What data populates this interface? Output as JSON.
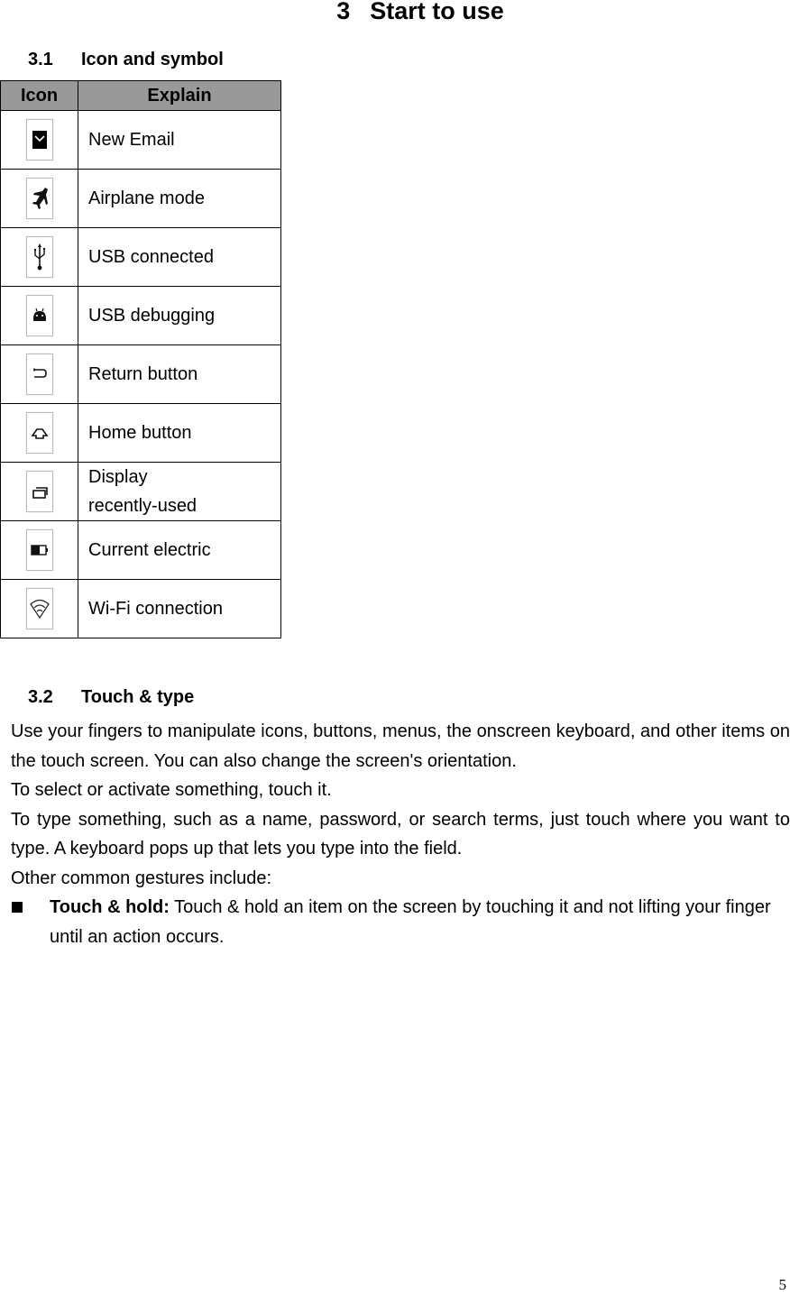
{
  "chapter": {
    "number": "3",
    "title": "Start to use"
  },
  "section_3_1": {
    "number": "3.1",
    "title": "Icon and symbol",
    "table": {
      "headers": [
        "Icon",
        "Explain"
      ],
      "header_bg": "#999999",
      "rows": [
        {
          "icon": "new-email-icon",
          "explain": "New Email"
        },
        {
          "icon": "airplane-mode-icon",
          "explain": "Airplane mode"
        },
        {
          "icon": "usb-connected-icon",
          "explain": "USB connected"
        },
        {
          "icon": "usb-debugging-icon",
          "explain": "USB debugging"
        },
        {
          "icon": "return-button-icon",
          "explain": "Return button"
        },
        {
          "icon": "home-button-icon",
          "explain": "Home button"
        },
        {
          "icon": "recent-apps-icon",
          "explain_line1": "Display",
          "explain_line2": "recently-used"
        },
        {
          "icon": "battery-icon",
          "explain": "Current electric"
        },
        {
          "icon": "wifi-icon",
          "explain": "Wi-Fi connection"
        }
      ]
    }
  },
  "section_3_2": {
    "number": "3.2",
    "title": "Touch & type",
    "paragraphs": [
      "Use your fingers to manipulate icons, buttons, menus, the onscreen keyboard, and other items on the touch screen. You can also change the screen's orientation.",
      "To select or activate something, touch it.",
      "To type something, such as a name, password, or search terms, just touch where you want to type. A keyboard pops up that lets you type into the field.",
      "Other common gestures include:"
    ],
    "bullets": [
      {
        "term": "Touch & hold:",
        "text": " Touch & hold an item on the screen by touching it and not lifting your finger until an action occurs."
      }
    ]
  },
  "page_number": "5"
}
